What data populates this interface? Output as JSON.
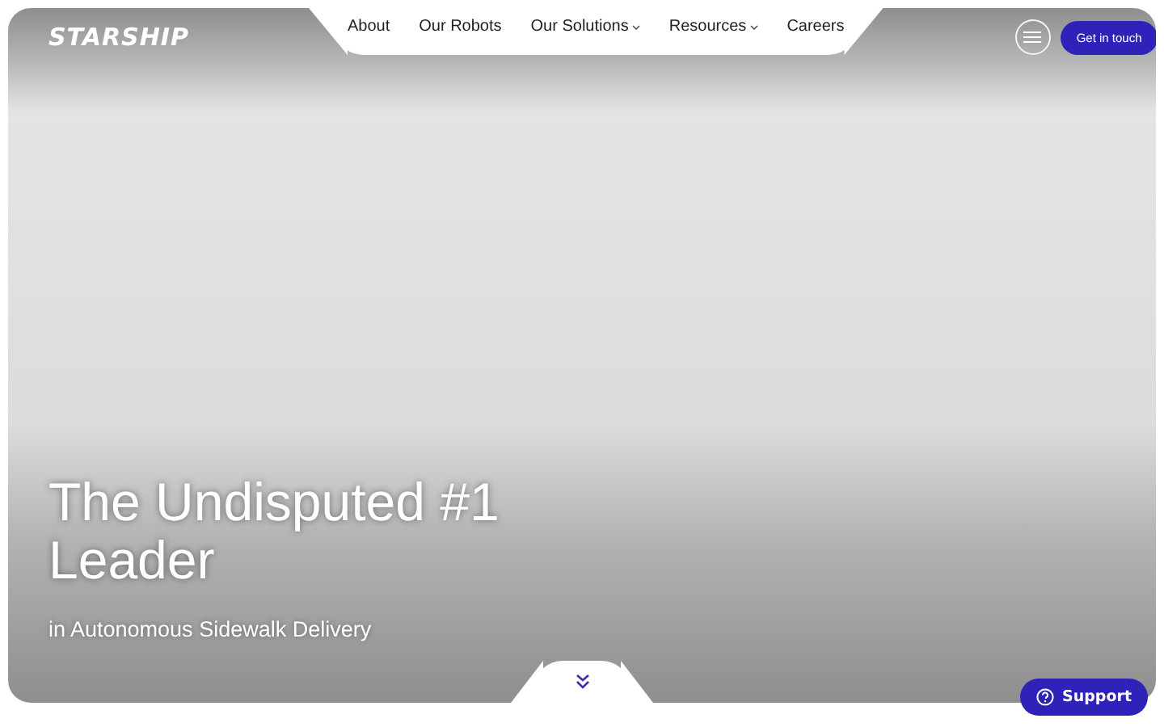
{
  "logo": "STARSHIP",
  "nav": [
    {
      "label": "About",
      "dropdown": false
    },
    {
      "label": "Our Robots",
      "dropdown": false
    },
    {
      "label": "Our Solutions",
      "dropdown": true
    },
    {
      "label": "Resources",
      "dropdown": true
    },
    {
      "label": "Careers",
      "dropdown": false
    }
  ],
  "cta": "Get in touch",
  "hero": {
    "title": "The Undisputed #1 Leader",
    "subtitle": "in Autonomous Sidewalk Delivery"
  },
  "support_button": "Support"
}
